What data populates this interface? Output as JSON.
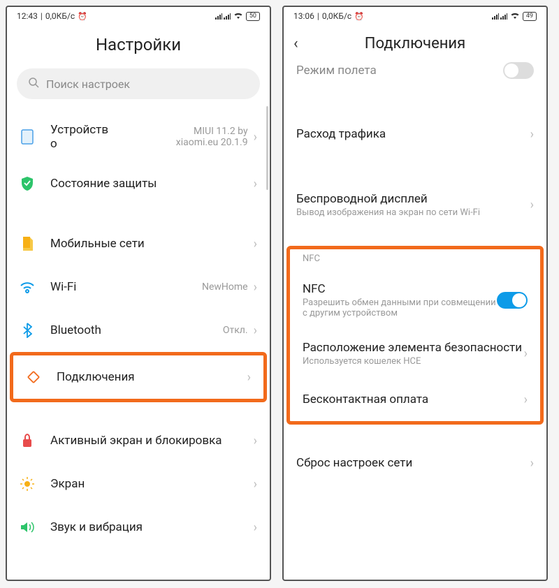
{
  "left": {
    "status": {
      "time": "12:43",
      "net": "0,0КБ/с",
      "battery": "50"
    },
    "title": "Настройки",
    "search_placeholder": "Поиск настроек",
    "items": {
      "device": {
        "label": "Устройство",
        "label_line1": "Устройств",
        "label_line2": "о",
        "value_line1": "MIUI 11.2 by",
        "value_line2": "xiaomi.eu 20.1.9"
      },
      "security": {
        "label": "Состояние защиты"
      },
      "mobile": {
        "label": "Мобильные сети"
      },
      "wifi": {
        "label": "Wi-Fi",
        "value": "NewHome"
      },
      "bluetooth": {
        "label": "Bluetooth",
        "value": "Откл."
      },
      "connections": {
        "label": "Подключения"
      },
      "lock": {
        "label": "Активный экран и блокировка"
      },
      "display": {
        "label": "Экран"
      },
      "sound": {
        "label": "Звук и вибрация"
      }
    }
  },
  "right": {
    "status": {
      "time": "13:06",
      "net": "0,0КБ/с",
      "battery": "49"
    },
    "title": "Подключения",
    "partial_top": "Режим полета",
    "items": {
      "traffic": {
        "label": "Расход трафика"
      },
      "cast": {
        "label": "Беспроводной дисплей",
        "sub": "Вывод изображения на экран по сети Wi-Fi"
      },
      "section": "NFC",
      "nfc": {
        "label": "NFC",
        "sub": "Разрешить обмен данными при совмещении с другим устройством"
      },
      "secure": {
        "label": "Расположение элемента безопасности",
        "sub": "Используется кошелек HCE"
      },
      "pay": {
        "label": "Бесконтактная оплата"
      },
      "reset": {
        "label": "Сброс настроек сети"
      }
    }
  }
}
